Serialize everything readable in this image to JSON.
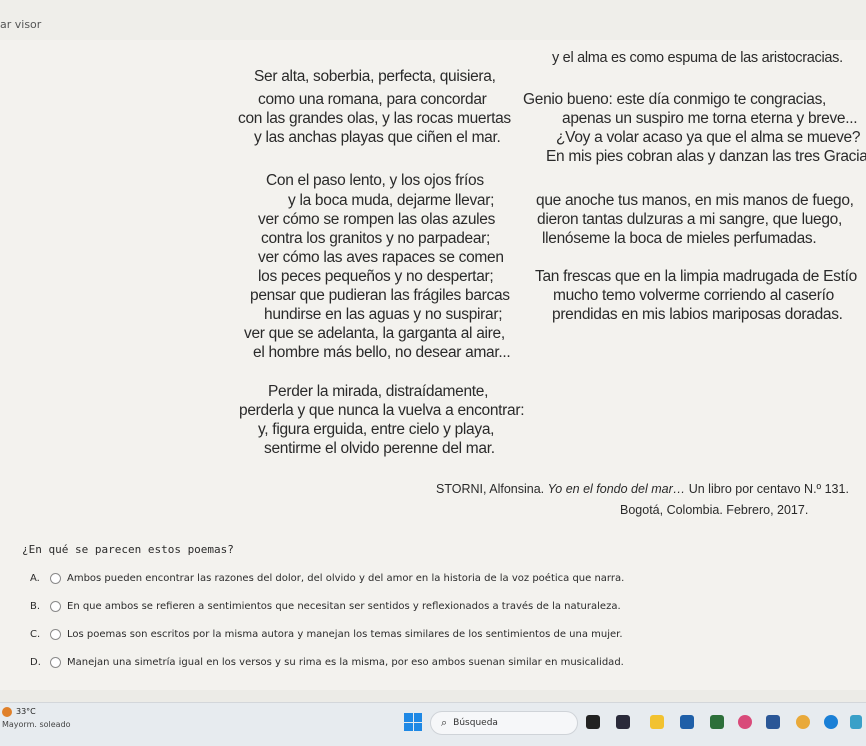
{
  "window": {
    "title_fragment": "ar visor"
  },
  "left_poem": {
    "lines": [
      "Ser alta, soberbia, perfecta, quisiera,",
      "como una romana, para concordar",
      "con las grandes olas, y las rocas muertas",
      "y las anchas playas que ciñen el mar.",
      "",
      "Con el paso lento, y los ojos fríos",
      "y la boca muda, dejarme llevar;",
      "ver cómo se rompen las olas azules",
      "contra los granitos y no parpadear;",
      "ver cómo las aves rapaces se comen",
      "los peces pequeños y no despertar;",
      "pensar que pudieran las frágiles barcas",
      "hundirse en las aguas y no suspirar;",
      "ver que se adelanta, la garganta al aire,",
      "el hombre más bello, no desear amar...",
      "",
      "Perder la mirada, distraídamente,",
      "perderla y que nunca la vuelva a encontrar:",
      "y, figura erguida, entre cielo y playa,",
      "sentirme el olvido perenne del mar."
    ]
  },
  "right_poem": {
    "lines": [
      "y el alma es como espuma de las aristocracias.",
      "",
      "Genio bueno: este día conmigo te congracias,",
      "apenas un suspiro me torna eterna y breve...",
      "¿Voy a volar acaso ya que el alma se mueve?",
      "En mis pies cobran alas y danzan las tres Gracias.",
      "",
      "que anoche tus manos, en mis manos de fuego,",
      "dieron tantas dulzuras a mi sangre, que luego,",
      "llenóseme la boca de mieles perfumadas.",
      "",
      "Tan frescas que en la limpia madrugada de Estío",
      "mucho temo volverme corriendo al caserío",
      "prendidas en mis labios mariposas doradas."
    ]
  },
  "citation": {
    "author": "STORNI, Alfonsina.",
    "title": "Yo en el fondo del mar…",
    "rest": "Un libro por centavo N.º 131.",
    "place": "Bogotá, Colombia. Febrero, 2017."
  },
  "question": {
    "text": "¿En qué se parecen estos poemas?",
    "options": [
      {
        "letter": "A.",
        "text": "Ambos pueden encontrar las razones del dolor, del olvido y del amor en la historia de la voz poética que narra."
      },
      {
        "letter": "B.",
        "text": "En que ambos se refieren a sentimientos que necesitan ser sentidos y reflexionados a través de la naturaleza."
      },
      {
        "letter": "C.",
        "text": "Los poemas son escritos por la misma autora y manejan los temas similares de los sentimientos de una mujer."
      },
      {
        "letter": "D.",
        "text": "Manejan una simetría igual en los versos y su rima es la misma, por eso ambos suenan similar en musicalidad."
      }
    ]
  },
  "taskbar": {
    "temperature": "33°C",
    "weather": "Mayorm. soleado",
    "search_label": "Búsqueda",
    "colors": {
      "windows": "#1e88e5"
    }
  }
}
